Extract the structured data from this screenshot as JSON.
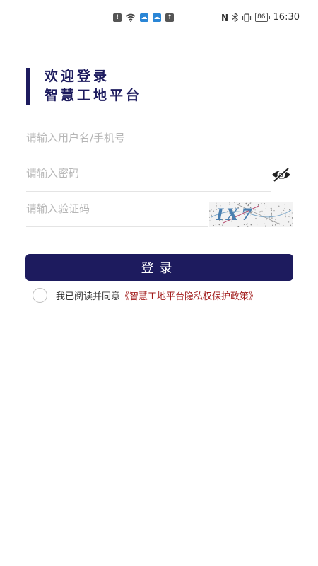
{
  "status_bar": {
    "time": "16:30",
    "battery": "86",
    "nfc": "N",
    "icons_left": [
      "alert-icon",
      "wifi-icon",
      "weather-icon",
      "cloud-icon",
      "upload-icon"
    ],
    "icons_right": [
      "nfc-icon",
      "bluetooth-icon",
      "vibrate-icon",
      "battery-icon"
    ]
  },
  "header": {
    "line1": "欢迎登录",
    "line2": "智慧工地平台"
  },
  "form": {
    "username_placeholder": "请输入用户名/手机号",
    "password_placeholder": "请输入密码",
    "captcha_placeholder": "请输入验证码",
    "username_value": "",
    "password_value": "",
    "captcha_value": "",
    "captcha_text": "IX7"
  },
  "login_button_label": "登录",
  "agreement": {
    "text": "我已阅读并同意",
    "link": "《智慧工地平台隐私权保护政策》"
  },
  "colors": {
    "primary": "#1d1b5e",
    "link": "#a11a1a",
    "placeholder": "#b6b6b6",
    "divider": "#e4e4e4"
  }
}
